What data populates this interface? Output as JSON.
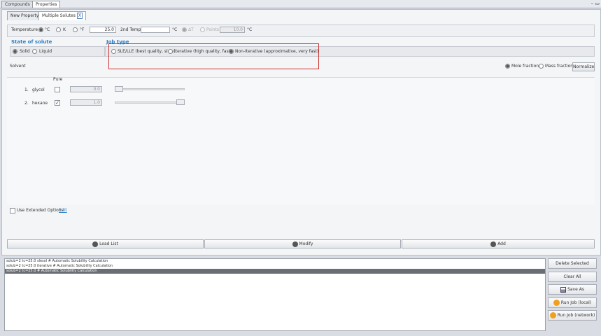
{
  "top_tabs": [
    "Compounds",
    "Properties"
  ],
  "sub_tabs": {
    "new_property": "New Property",
    "multiple_solutes": "Multiple Solutes",
    "close": "X"
  },
  "temperature": {
    "label": "Temperature",
    "unit_c": "°C",
    "unit_k": "K",
    "unit_f": "°F",
    "value": "25.0",
    "second_label": "2nd Temp",
    "second_value": "",
    "second_unit": "°C",
    "dt": "ΔT",
    "points": "Points",
    "points_value": "10.0",
    "points_unit": "°C"
  },
  "state_of_solute": {
    "title": "State of solute",
    "solid": "Solid",
    "liquid": "Liquid"
  },
  "job_type": {
    "title": "Job type",
    "sle": "SLE/LLE (best quality, slow)",
    "iterative": "Iterative (high quality, fast)",
    "non_iterative": "Non-Iterative (approximative, very fast)"
  },
  "solvent": {
    "label": "Solvent",
    "mole_fraction": "Mole fraction",
    "mass_fraction": "Mass fraction",
    "normalize": "Normalize",
    "pure_header": "Pure",
    "rows": [
      {
        "index": "1.",
        "name": "glycol",
        "checked": "",
        "value": "0.0"
      },
      {
        "index": "2.",
        "name": "hexane",
        "checked": "✓",
        "value": "1.0"
      }
    ]
  },
  "extended": {
    "label": "Use Extended Options",
    "edit": "Edit"
  },
  "actions": {
    "load_list": "Load List",
    "modify": "Modify",
    "add": "Add"
  },
  "jobs": [
    "solub=2 tc=25.0 slesol # Automatic Solubility Calculation",
    "solub=2 tc=25.0 iterative # Automatic Solubility Calculation",
    "solub=2 tc=25.0 # Automatic Solubility Calculation"
  ],
  "right_buttons": {
    "delete_selected": "Delete Selected",
    "clear_all": "Clear All",
    "save_as": "Save As",
    "run_local": "Run Job (local)",
    "run_network": "Run Job (network)"
  },
  "colors": {
    "accent": "#2d7fc4",
    "highlight_box": "#cc3333",
    "selected_row": "#6b6f75",
    "run_icon": "#f0a020"
  }
}
